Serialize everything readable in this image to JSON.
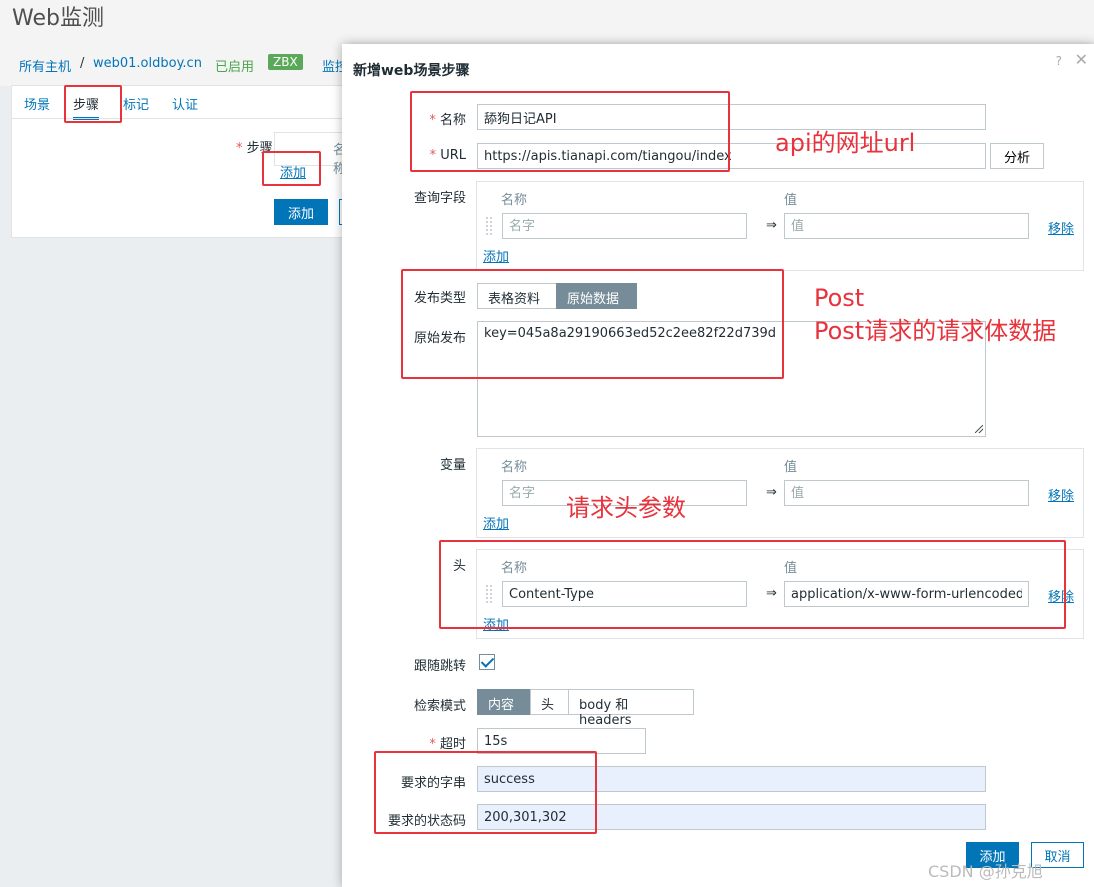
{
  "page": {
    "title": "Web监测"
  },
  "breadcrumb": {
    "all_hosts": "所有主机",
    "separator": "/",
    "host": "web01.oldboy.cn",
    "status": "已启用",
    "badge": "ZBX",
    "monitor": "监控"
  },
  "tabs": [
    "场景",
    "步骤",
    "标记",
    "认证"
  ],
  "steps_panel": {
    "label": "步骤",
    "required": "*",
    "name_header": "名称",
    "add_link": "添加",
    "add_button": "添加"
  },
  "dialog": {
    "title": "新增web场景步骤",
    "help": "?",
    "close": "✕",
    "name": {
      "label": "名称",
      "value": "舔狗日记API"
    },
    "url": {
      "label": "URL",
      "value": "https://apis.tianapi.com/tiangou/index",
      "analyze": "分析"
    },
    "query": {
      "label": "查询字段",
      "col_name": "名称",
      "col_value": "值",
      "name_placeholder": "名字",
      "value_placeholder": "值",
      "arrow": "⇒",
      "remove": "移除",
      "add": "添加"
    },
    "post_type": {
      "label": "发布类型",
      "options": [
        "表格资料",
        "原始数据"
      ],
      "selected": 1
    },
    "raw_post": {
      "label": "原始发布",
      "value": "key=045a8a29190663ed52c2ee82f22d739d"
    },
    "variables": {
      "label": "变量",
      "col_name": "名称",
      "col_value": "值",
      "name_placeholder": "名字",
      "value_placeholder": "值",
      "arrow": "⇒",
      "remove": "移除",
      "add": "添加"
    },
    "headers": {
      "label": "头",
      "col_name": "名称",
      "col_value": "值",
      "name": "Content-Type",
      "value": "application/x-www-form-urlencoded",
      "arrow": "⇒",
      "remove": "移除",
      "add": "添加"
    },
    "follow_redirects": {
      "label": "跟随跳转",
      "checked": true
    },
    "retrieve_mode": {
      "label": "检索模式",
      "options": [
        "内容",
        "头",
        "body 和 headers"
      ],
      "selected": 0
    },
    "timeout": {
      "label": "超时",
      "value": "15s"
    },
    "required_string": {
      "label": "要求的字串",
      "value": "success"
    },
    "required_status": {
      "label": "要求的状态码",
      "value": "200,301,302"
    },
    "add_button": "添加",
    "cancel_button": "取消"
  },
  "annotations": {
    "url_note": "api的网址url",
    "post_title": "Post",
    "post_note": "Post请求的请求体数据",
    "header_note": "请求头参数"
  },
  "watermark": "CSDN @孙克旭",
  "colors": {
    "accent": "#0275b8",
    "annotation_red": "#e8323c",
    "enabled_green": "#4aa64a"
  }
}
